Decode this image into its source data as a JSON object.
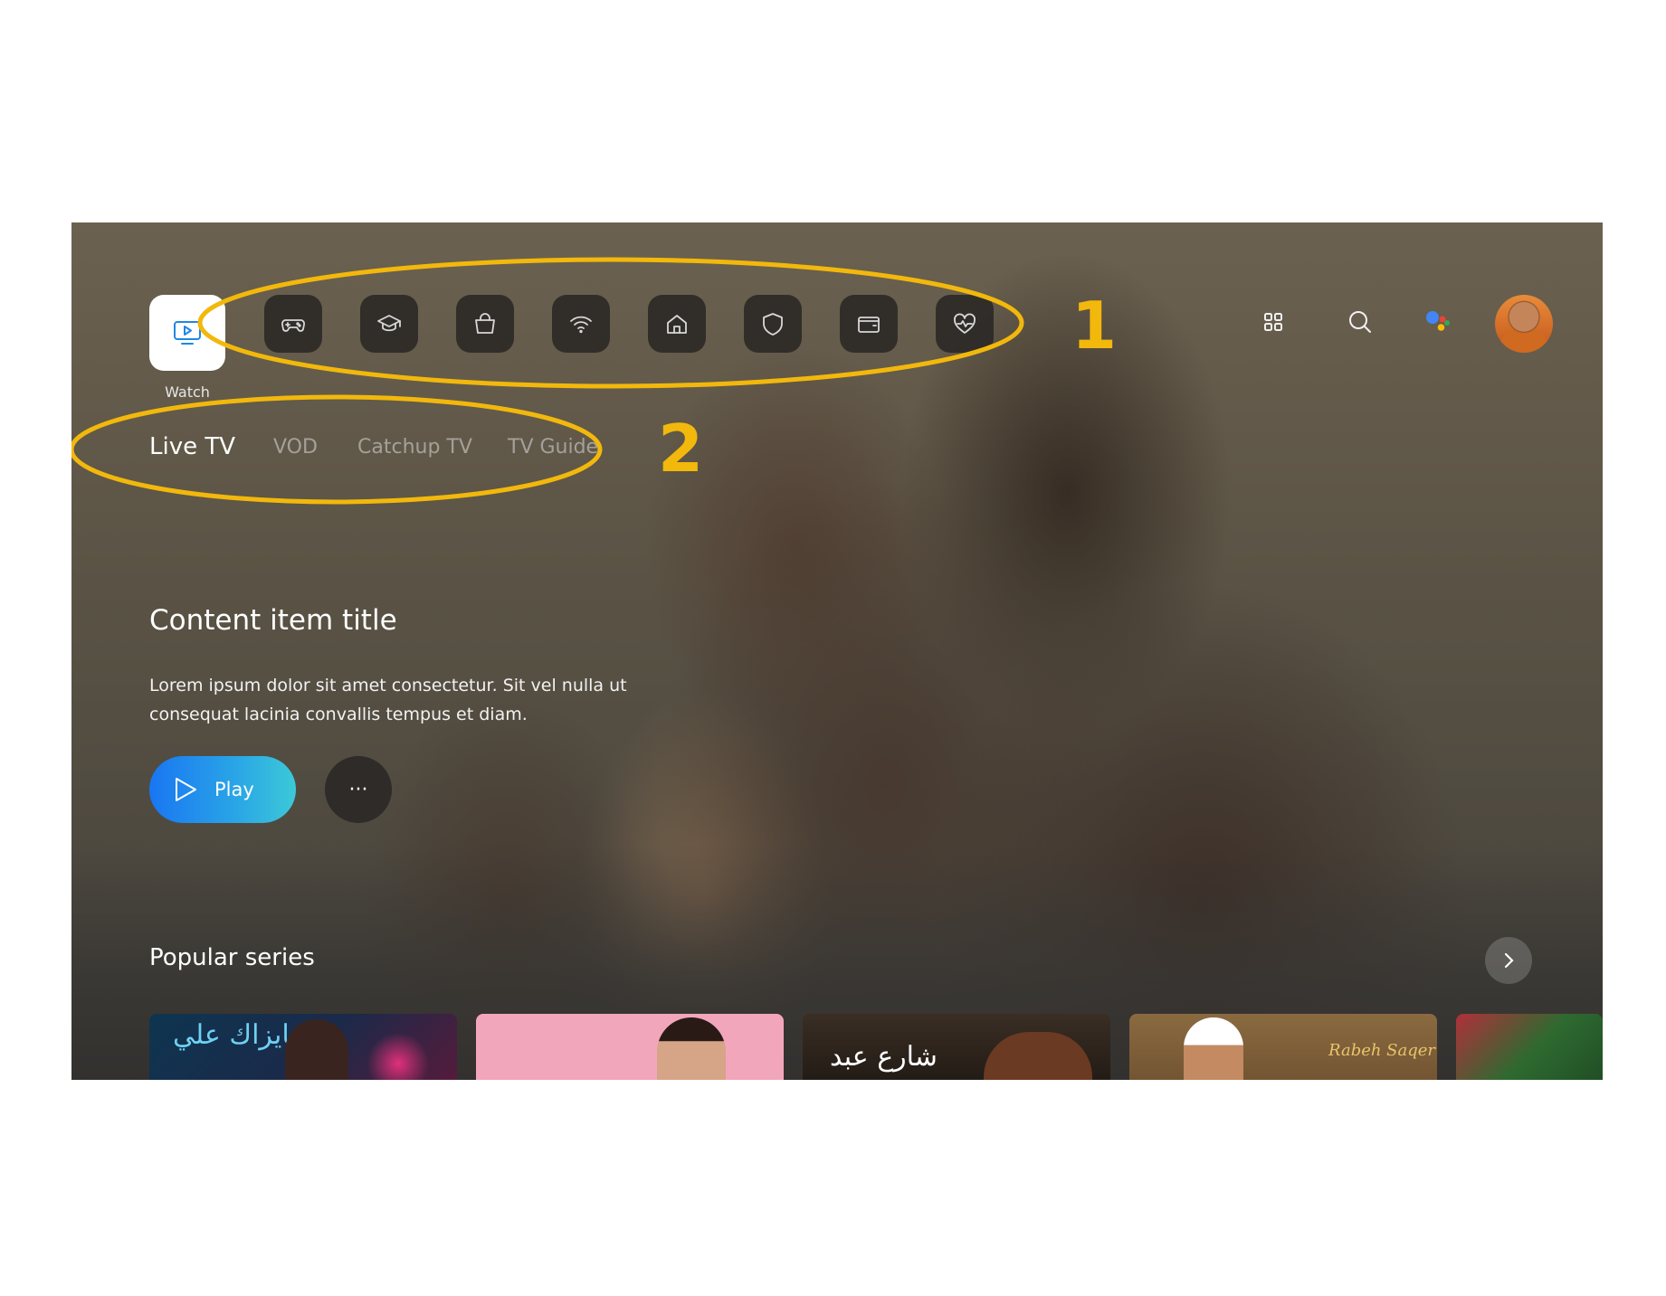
{
  "nav": {
    "watch_label": "Watch",
    "icons": [
      "gamepad-icon",
      "graduation-cap-icon",
      "shopping-bag-icon",
      "wifi-icon",
      "home-icon",
      "shield-icon",
      "wallet-icon",
      "heart-pulse-icon"
    ],
    "right_icons": [
      "apps-grid-icon",
      "search-icon",
      "google-assistant-icon",
      "user-avatar"
    ]
  },
  "subnav": {
    "tabs": [
      {
        "label": "Live TV",
        "active": true
      },
      {
        "label": "VOD",
        "active": false
      },
      {
        "label": "Catchup TV",
        "active": false
      },
      {
        "label": "TV Guide",
        "active": false
      }
    ]
  },
  "hero": {
    "title": "Content item title",
    "description": "Lorem ipsum dolor sit amet consectetur. Sit vel nulla ut consequat lacinia convallis tempus et diam.",
    "play_label": "Play",
    "more_label": "···"
  },
  "popular": {
    "title": "Popular series",
    "cards": [
      {
        "text": "عايزاك علي"
      },
      {
        "text": ""
      },
      {
        "text": "شارع عبد"
      },
      {
        "text": "Rabeh Saqer"
      },
      {
        "text": ""
      }
    ]
  },
  "annotations": {
    "one": "1",
    "two": "2"
  },
  "colors": {
    "annotation": "#f2b80c",
    "accent": "#1e88e5",
    "play_gradient_start": "#1976f2",
    "play_gradient_end": "#3cc9d8"
  }
}
